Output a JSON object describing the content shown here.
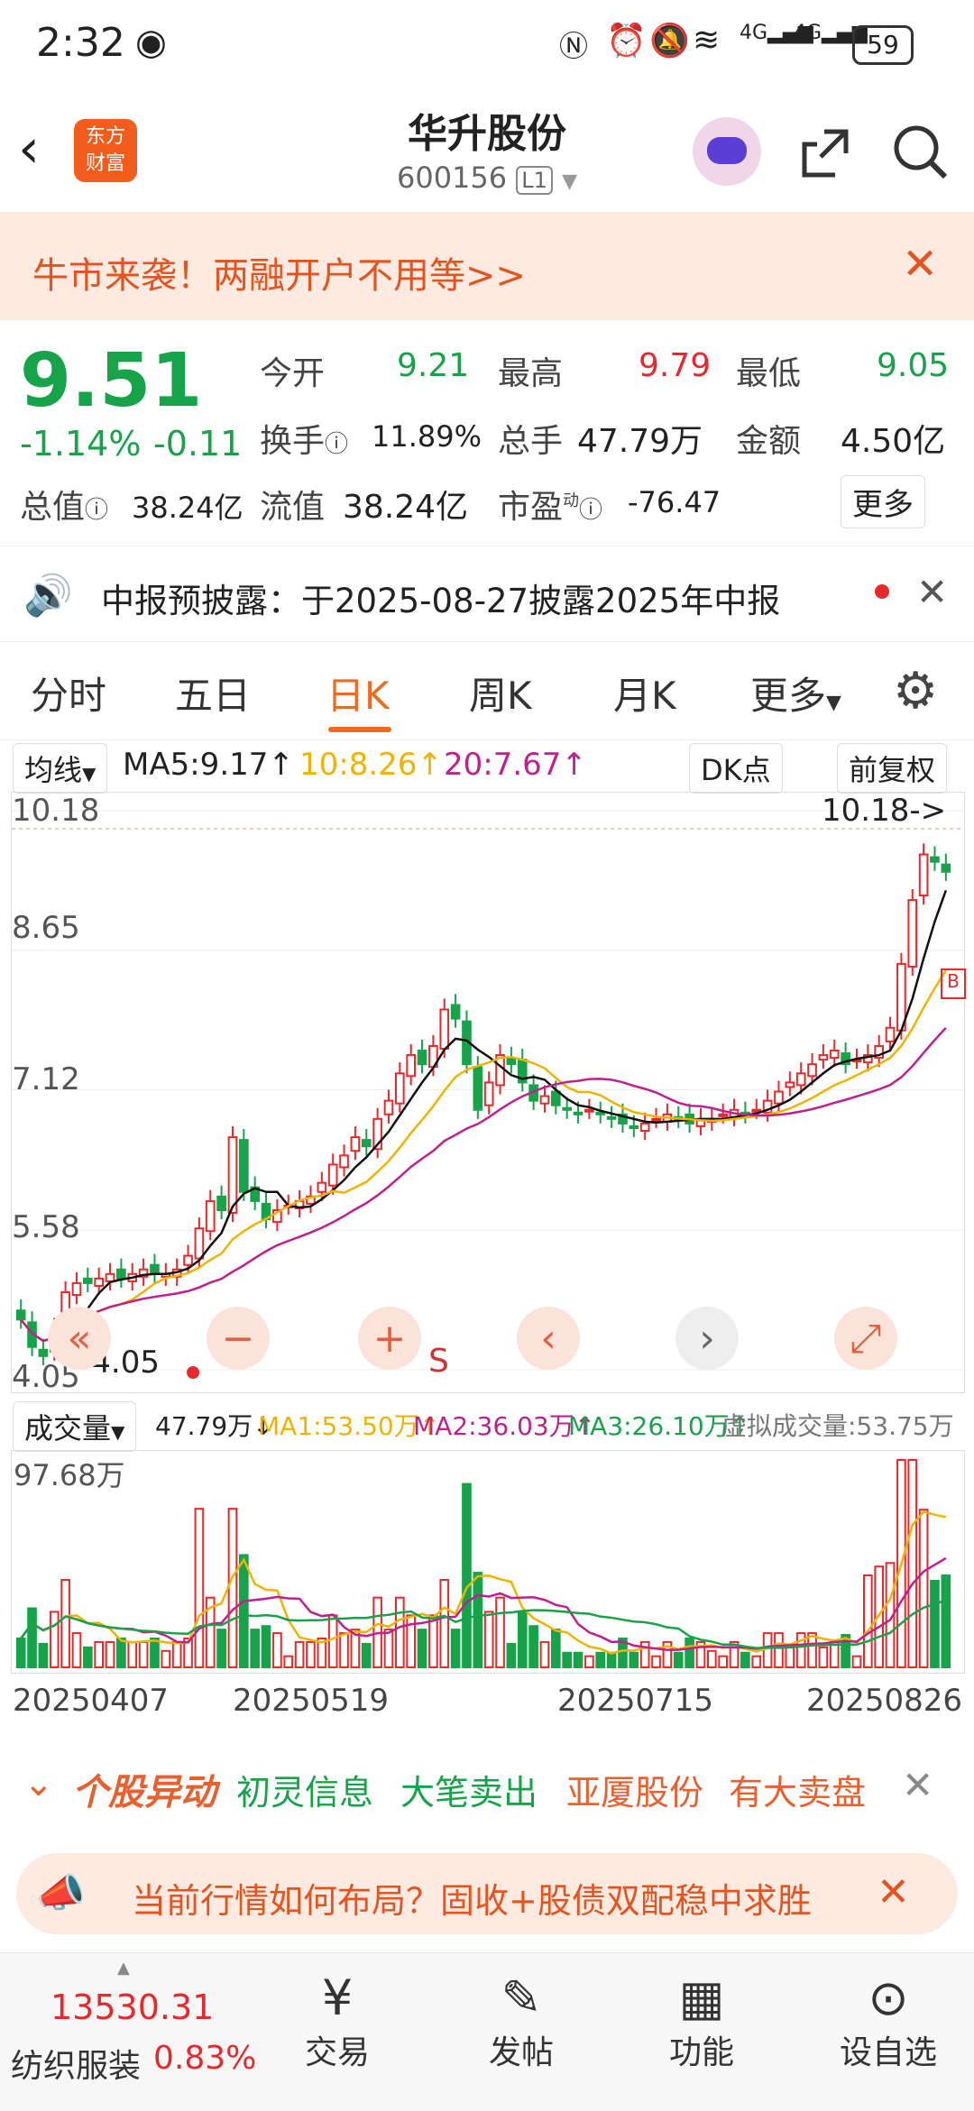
{
  "status": {
    "time": "2:32",
    "battery": "59",
    "signal1": "4G",
    "signal2": "4G"
  },
  "nav": {
    "logo_line1": "东方",
    "logo_line2": "财富",
    "title": "华升股份",
    "code": "600156",
    "level": "L1"
  },
  "promo": {
    "text": "牛市来袭！两融开户不用等>>"
  },
  "quote": {
    "price": "9.51",
    "change_pct": "-1.14%",
    "change": "-0.11",
    "open_label": "今开",
    "open": "9.21",
    "high_label": "最高",
    "high": "9.79",
    "low_label": "最低",
    "low": "9.05",
    "turnover_label": "换手",
    "turnover": "11.89%",
    "volume_label": "总手",
    "volume": "47.79万",
    "amount_label": "金额",
    "amount": "4.50亿",
    "mktcap_label": "总值",
    "mktcap": "38.24亿",
    "float_label": "流值",
    "float": "38.24亿",
    "pe_label": "市盈",
    "pe_sup": "动",
    "pe": "-76.47",
    "more": "更多"
  },
  "notice": {
    "text": "中报预披露：于2025-08-27披露2025年中报"
  },
  "tabs": [
    "分时",
    "五日",
    "日K",
    "周K",
    "月K",
    "更多"
  ],
  "tabs_active": 2,
  "chartbar": {
    "ma_select": "均线",
    "ma5": "MA5:9.17↑",
    "ma10": "10:8.26↑",
    "ma20": "20:7.67↑",
    "dk": "DK点",
    "fq": "前复权"
  },
  "chart_data": {
    "type": "candlestick",
    "y_ticks": [
      "10.18",
      "8.65",
      "7.12",
      "5.58",
      "4.05"
    ],
    "ylim": [
      4.05,
      10.18
    ],
    "high_marker": "10.18->",
    "low_marker": "-4.05",
    "colors": {
      "up": "#e8282b",
      "down": "#17a34a",
      "ma5": "#111111",
      "ma10": "#f0b400",
      "ma20": "#c0208f"
    },
    "x_labels": [
      "20250407",
      "20250519",
      "20250715",
      "20250826"
    ],
    "close_series": [
      4.6,
      4.3,
      4.2,
      4.5,
      4.9,
      5.0,
      5.0,
      5.05,
      5.1,
      5.05,
      5.1,
      5.15,
      5.1,
      5.1,
      5.15,
      5.3,
      5.6,
      5.9,
      5.8,
      6.6,
      6.0,
      5.9,
      5.7,
      5.8,
      5.85,
      5.9,
      5.95,
      6.1,
      6.3,
      6.4,
      6.6,
      6.5,
      6.8,
      7.0,
      7.3,
      7.5,
      7.4,
      7.6,
      8.0,
      7.9,
      7.4,
      6.9,
      7.2,
      7.5,
      7.4,
      7.2,
      7.0,
      7.05,
      6.95,
      6.9,
      6.85,
      6.9,
      6.85,
      6.8,
      6.75,
      6.7,
      6.75,
      6.8,
      6.85,
      6.8,
      6.75,
      6.8,
      6.8,
      6.85,
      6.9,
      6.85,
      6.9,
      7.0,
      7.1,
      7.2,
      7.3,
      7.4,
      7.5,
      7.55,
      7.4,
      7.45,
      7.5,
      7.6,
      7.8,
      8.5,
      9.2,
      9.7,
      9.62,
      9.51
    ],
    "volume_axis_max": "97.68万"
  },
  "volbar": {
    "select": "成交量",
    "vol": "47.79万↓",
    "ma1": "MA1:53.50万↑",
    "ma2": "MA2:36.03万↑",
    "ma3": "MA3:26.10万↑",
    "virtual": "虚拟成交量:53.75万"
  },
  "alert": {
    "brand": "个股异动",
    "item1_name": "初灵信息",
    "item1_event": "大笔卖出",
    "item2_name": "亚厦股份",
    "item2_event": "有大卖盘"
  },
  "ad": {
    "text": "当前行情如何布局？固收+股债双配稳中求胜"
  },
  "bottom": {
    "index_value": "13530.31",
    "index_name": "纺织服装",
    "index_pct": "0.83%",
    "items": [
      "交易",
      "发帖",
      "功能",
      "设自选"
    ]
  }
}
